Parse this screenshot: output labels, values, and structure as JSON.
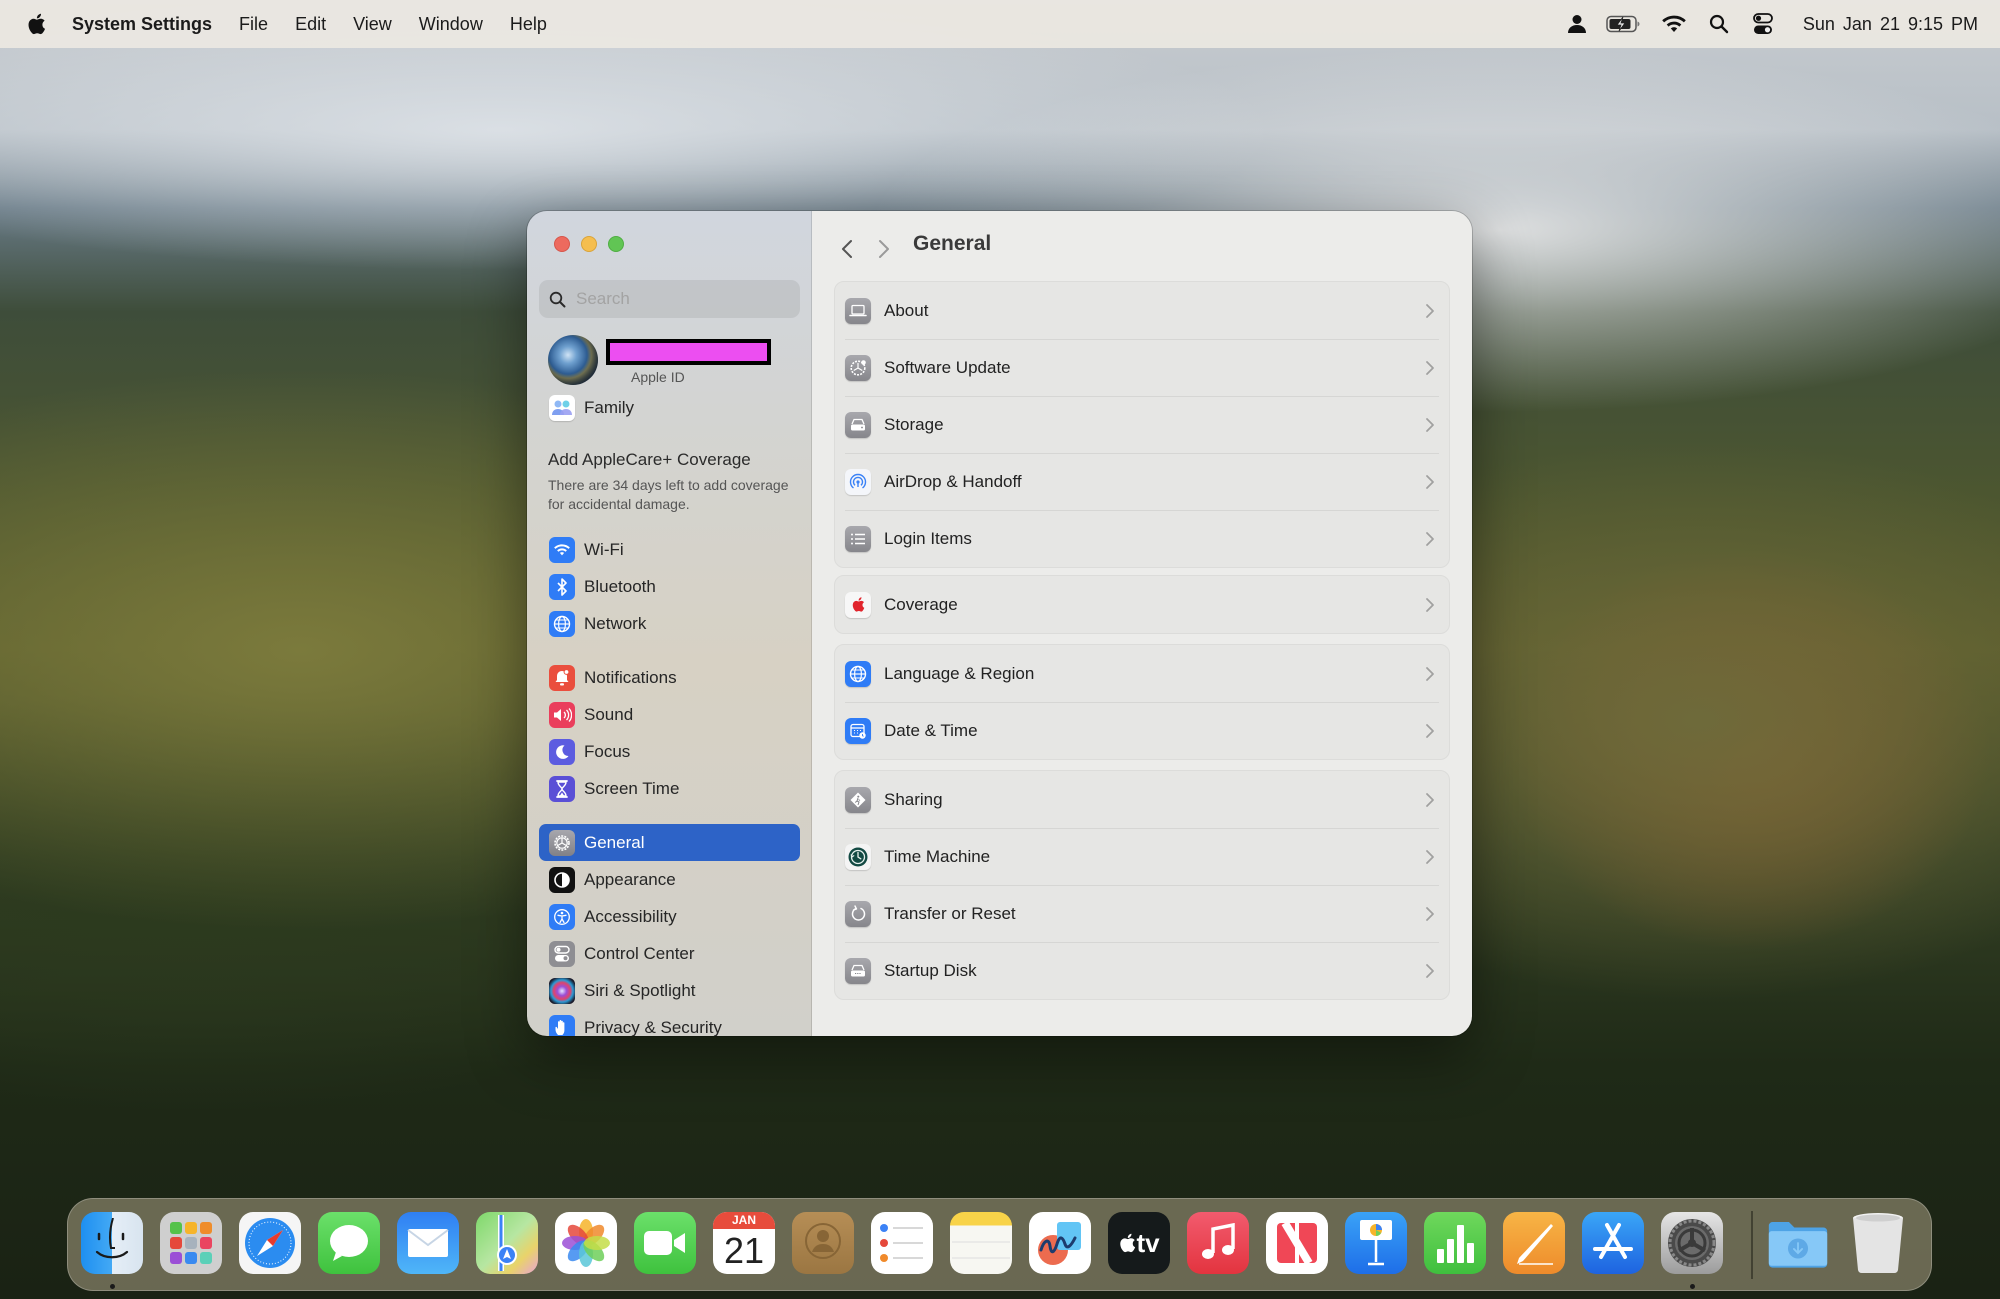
{
  "menubar": {
    "app_name": "System Settings",
    "menus": [
      "File",
      "Edit",
      "View",
      "Window",
      "Help"
    ],
    "status_icons": [
      "user-icon",
      "battery-charging-icon",
      "wifi-icon",
      "spotlight-search-icon",
      "control-center-icon"
    ],
    "clock": "Sun Jan 21  9:15 PM"
  },
  "window": {
    "sidebar": {
      "search_placeholder": "Search",
      "apple_id": {
        "name_redacted": true,
        "subtitle": "Apple ID"
      },
      "family_label": "Family",
      "applecare": {
        "title": "Add AppleCare+ Coverage",
        "description": "There are 34 days left to add coverage for accidental damage."
      },
      "items": [
        {
          "label": "Wi-Fi",
          "icon": "wifi-icon",
          "color": "#2f7cf6"
        },
        {
          "label": "Bluetooth",
          "icon": "bluetooth-icon",
          "color": "#2f7cf6"
        },
        {
          "label": "Network",
          "icon": "globe-icon",
          "color": "#2f7cf6"
        },
        {
          "label": "Notifications",
          "icon": "bell-icon",
          "color": "#ea4e3d"
        },
        {
          "label": "Sound",
          "icon": "speaker-icon",
          "color": "#ea3e5c"
        },
        {
          "label": "Focus",
          "icon": "moon-icon",
          "color": "#5c5ce0"
        },
        {
          "label": "Screen Time",
          "icon": "hourglass-icon",
          "color": "#5a4fd6"
        },
        {
          "label": "General",
          "icon": "gear-icon",
          "color": "#8e8e93",
          "selected": true
        },
        {
          "label": "Appearance",
          "icon": "appearance-icon",
          "color": "#111111"
        },
        {
          "label": "Accessibility",
          "icon": "accessibility-icon",
          "color": "#2f7cf6"
        },
        {
          "label": "Control Center",
          "icon": "toggles-icon",
          "color": "#8e8e93"
        },
        {
          "label": "Siri & Spotlight",
          "icon": "siri-icon",
          "color": "#3a2a4a"
        },
        {
          "label": "Privacy & Security",
          "icon": "hand-icon",
          "color": "#2f7cf6"
        }
      ]
    },
    "content": {
      "title": "General",
      "groups": [
        [
          {
            "label": "About",
            "icon": "laptop-icon"
          },
          {
            "label": "Software Update",
            "icon": "gear-badge-icon"
          },
          {
            "label": "Storage",
            "icon": "drive-icon"
          },
          {
            "label": "AirDrop & Handoff",
            "icon": "airdrop-icon"
          },
          {
            "label": "Login Items",
            "icon": "list-icon"
          }
        ],
        [
          {
            "label": "Coverage",
            "icon": "apple-icon"
          }
        ],
        [
          {
            "label": "Language & Region",
            "icon": "globe-icon"
          },
          {
            "label": "Date & Time",
            "icon": "calendar-clock-icon"
          }
        ],
        [
          {
            "label": "Sharing",
            "icon": "sharing-icon"
          },
          {
            "label": "Time Machine",
            "icon": "time-machine-icon"
          },
          {
            "label": "Transfer or Reset",
            "icon": "reset-icon"
          },
          {
            "label": "Startup Disk",
            "icon": "startup-disk-icon"
          }
        ]
      ]
    }
  },
  "dock": {
    "apps": [
      {
        "name": "Finder",
        "running": true
      },
      {
        "name": "Launchpad"
      },
      {
        "name": "Safari"
      },
      {
        "name": "Messages"
      },
      {
        "name": "Mail"
      },
      {
        "name": "Maps"
      },
      {
        "name": "Photos"
      },
      {
        "name": "FaceTime"
      },
      {
        "name": "Calendar",
        "month": "JAN",
        "day": "21"
      },
      {
        "name": "Contacts"
      },
      {
        "name": "Reminders"
      },
      {
        "name": "Notes"
      },
      {
        "name": "Freeform"
      },
      {
        "name": "TV",
        "label": "tv"
      },
      {
        "name": "Music"
      },
      {
        "name": "News"
      },
      {
        "name": "Keynote"
      },
      {
        "name": "Numbers"
      },
      {
        "name": "Pages"
      },
      {
        "name": "App Store"
      },
      {
        "name": "System Settings",
        "running": true
      }
    ],
    "stacks": [
      {
        "name": "Downloads"
      },
      {
        "name": "Trash"
      }
    ]
  }
}
